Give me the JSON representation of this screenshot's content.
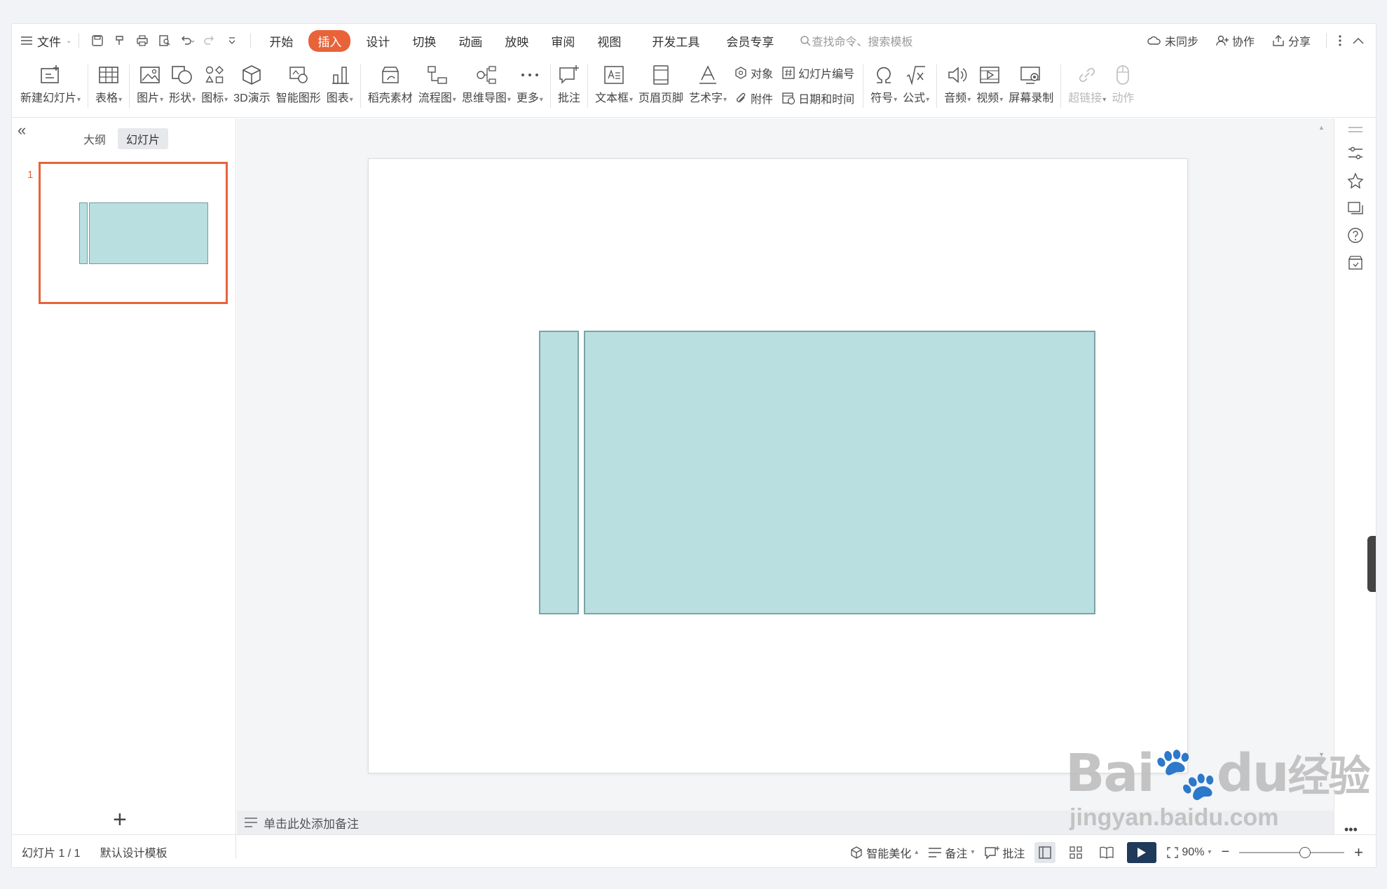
{
  "menu": {
    "file_label": "文件",
    "tabs": [
      "开始",
      "插入",
      "设计",
      "切换",
      "动画",
      "放映",
      "审阅",
      "视图",
      "开发工具",
      "会员专享"
    ],
    "active_tab": "插入",
    "search_placeholder": "查找命令、搜索模板",
    "right": {
      "sync": "未同步",
      "collab": "协作",
      "share": "分享"
    }
  },
  "ribbon": {
    "new_slide": "新建幻灯片",
    "table": "表格",
    "picture": "图片",
    "shape": "形状",
    "icon": "图标",
    "demo3d": "3D演示",
    "smartart": "智能图形",
    "chart": "图表",
    "material": "稻壳素材",
    "flowchart": "流程图",
    "mindmap": "思维导图",
    "more": "更多",
    "comment": "批注",
    "textbox": "文本框",
    "header_footer": "页眉页脚",
    "wordart": "艺术字",
    "object": "对象",
    "attachment": "附件",
    "slide_number": "幻灯片编号",
    "datetime": "日期和时间",
    "symbol": "符号",
    "formula": "公式",
    "audio": "音频",
    "video": "视频",
    "screen_record": "屏幕录制",
    "hyperlink": "超链接",
    "action": "动作"
  },
  "left_panel": {
    "tab_outline": "大纲",
    "tab_slides": "幻灯片",
    "slide_number": "1"
  },
  "notes": {
    "placeholder": "单击此处添加备注"
  },
  "status": {
    "slide_info": "幻灯片 1 / 1",
    "template": "默认设计模板",
    "beautify": "智能美化",
    "notes": "备注",
    "comment": "批注",
    "zoom": "90%"
  },
  "watermark": {
    "brand": "Bai",
    "brand2": "du",
    "cn": "经验",
    "url": "jingyan.baidu.com"
  },
  "colors": {
    "accent": "#e8633a",
    "shape_fill": "#b9dfe1",
    "shape_border": "#7aa4a6"
  }
}
